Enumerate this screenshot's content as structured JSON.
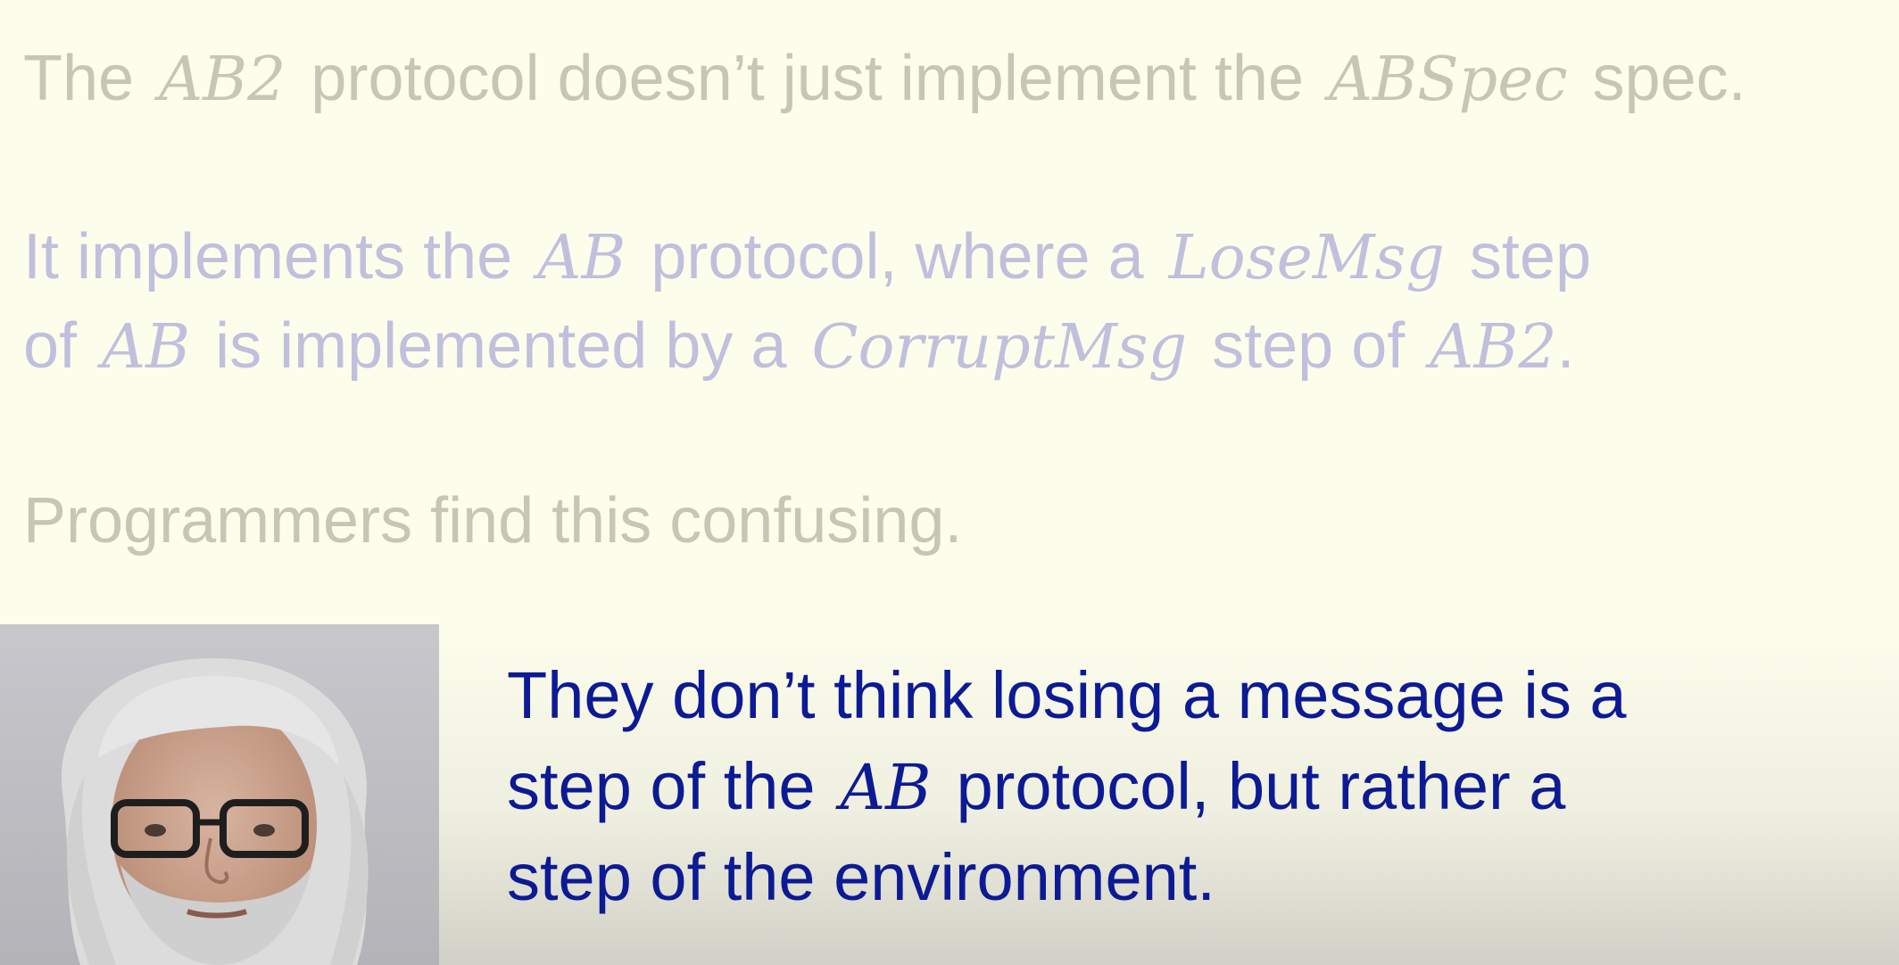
{
  "slide": {
    "line1": {
      "t1": "The",
      "m1": "AB2",
      "t2": "protocol doesn’t just implement the",
      "m2": "ABSpec",
      "t3": "spec."
    },
    "line2": {
      "t1": "It implements the",
      "m1": "AB",
      "t2": "protocol, where a",
      "m2": "LoseMsg",
      "t3": "step"
    },
    "line3": {
      "t1": "of",
      "m1": "AB",
      "t2": "is implemented by a",
      "m2": "CorruptMsg",
      "t3": "step of",
      "m3": "AB2",
      "t4": "."
    },
    "line4": {
      "t1": "Programmers find this confusing."
    },
    "caption": {
      "line1": "They don’t think losing a message is a",
      "line2_t1": "step of the",
      "line2_m1": "AB",
      "line2_t2": "protocol, but rather a",
      "line3": "step of the environment."
    }
  },
  "colors": {
    "background": "#fdfdec",
    "dim_gray_text": "#c6c5b6",
    "dim_blue_text": "#c0c0dd",
    "caption_text": "#0c1a94"
  },
  "icons": {
    "speaker": "speaker-video-thumbnail"
  }
}
